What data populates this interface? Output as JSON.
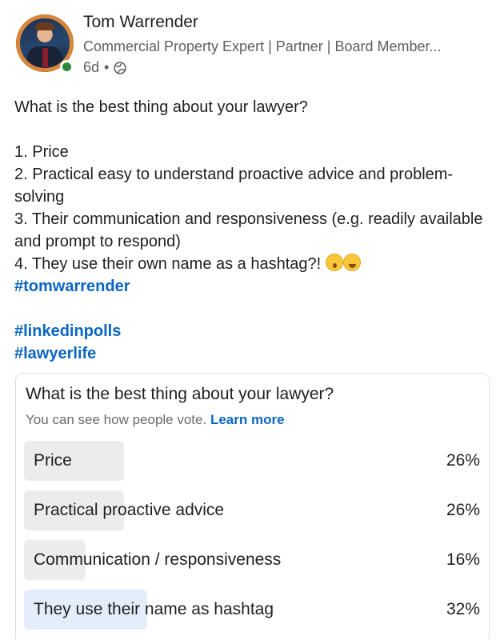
{
  "author": {
    "name": "Tom Warrender",
    "headline": "Commercial Property Expert | Partner | Board Member...",
    "time": "6d",
    "separator": "•"
  },
  "post": {
    "question": "What is the best thing about your lawyer?",
    "items": [
      "1. Price",
      "2. Practical easy to understand proactive advice and problem-solving",
      "3. Their communication and responsiveness (e.g. readily available and prompt to respond)",
      "4. They use their own name as a hashtag?!"
    ],
    "hashtags": [
      "#tomwarrender",
      "#linkedinpolls",
      "#lawyerlife"
    ]
  },
  "poll": {
    "question": "What is the best thing about your lawyer?",
    "note": "You can see how people vote.",
    "learn_more": "Learn more",
    "options": [
      {
        "label": "Price",
        "percent": "26%",
        "share": 0.26,
        "selected": false
      },
      {
        "label": "Practical proactive advice",
        "percent": "26%",
        "share": 0.26,
        "selected": false
      },
      {
        "label": "Communication / responsiveness",
        "percent": "16%",
        "share": 0.16,
        "selected": false
      },
      {
        "label": "They use their name as hashtag",
        "percent": "32%",
        "share": 0.32,
        "selected": true
      }
    ]
  },
  "colors": {
    "link": "#0a66c2",
    "online": "#2e8a3a",
    "bar": "#ececec",
    "bar_selected": "#e4eefa"
  },
  "icons": {
    "visibility": "globe-icon",
    "emoji_1": "astonished-face-icon",
    "emoji_2": "grinning-squinting-face-icon"
  }
}
